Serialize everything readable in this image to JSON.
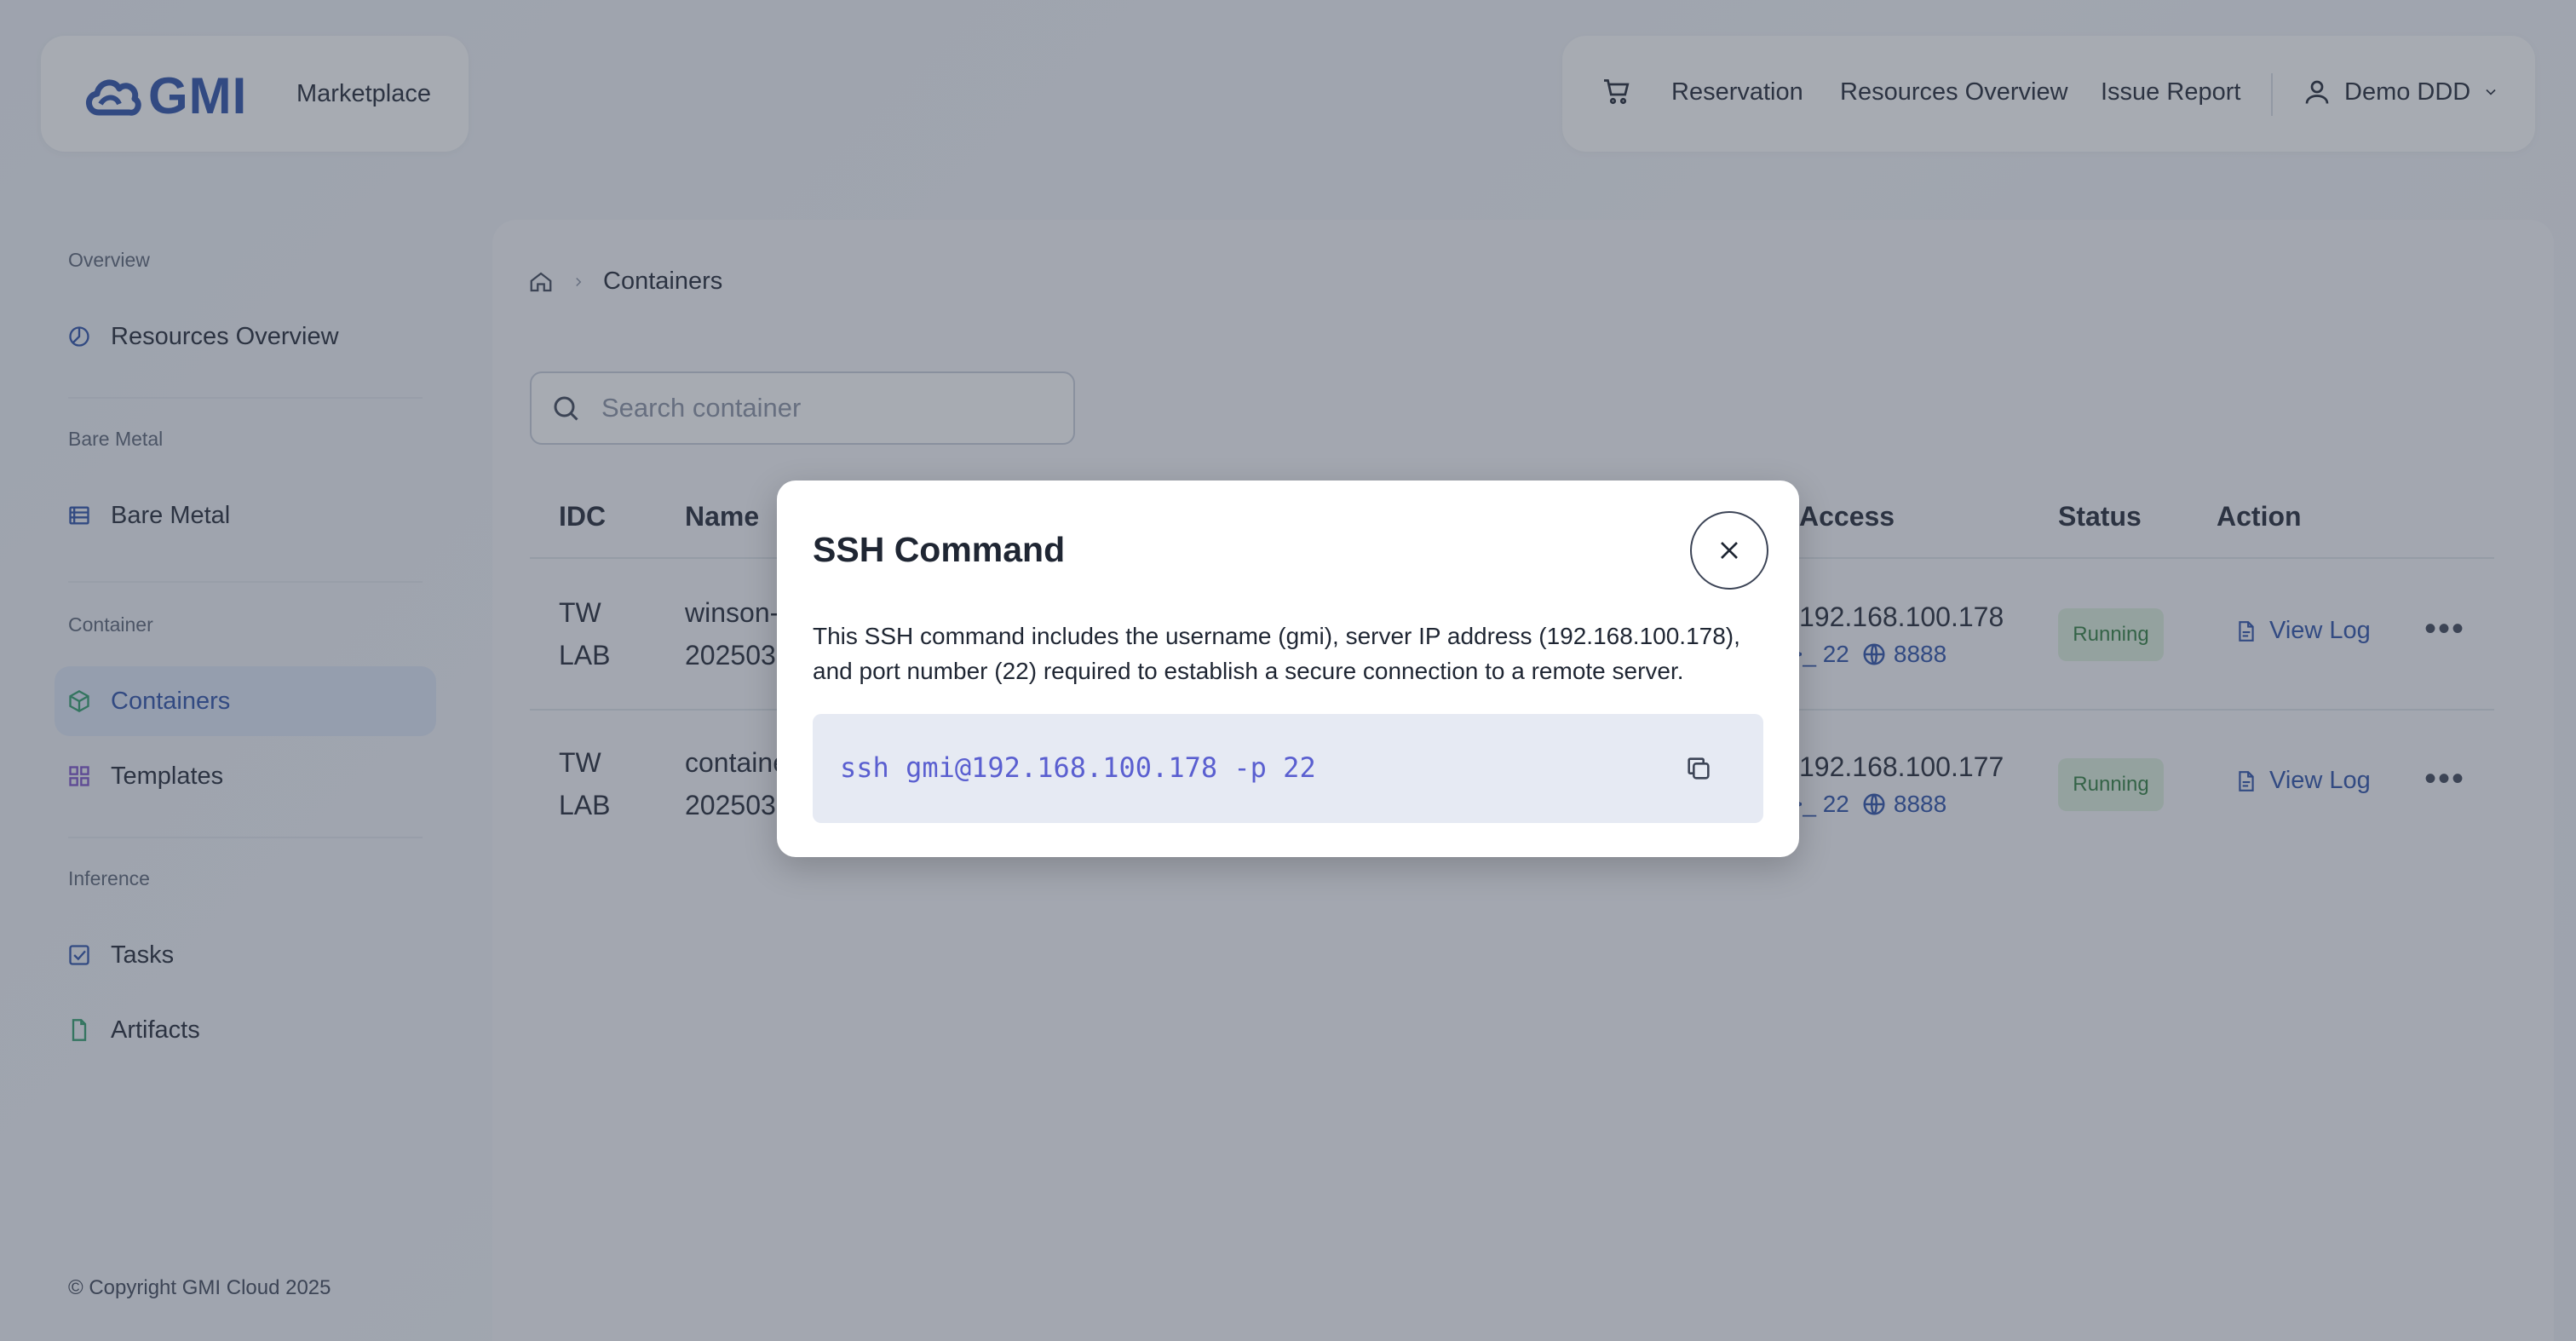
{
  "header": {
    "logo_text": "GMI",
    "marketplace_label": "Marketplace",
    "nav": {
      "cart_icon": "cart-icon",
      "reservation": "Reservation",
      "resources_overview": "Resources Overview",
      "issue_report": "Issue Report",
      "user_name": "Demo DDD"
    }
  },
  "sidebar": {
    "sections": {
      "overview": "Overview",
      "bare_metal": "Bare Metal",
      "container": "Container",
      "inference": "Inference"
    },
    "items": {
      "resources_overview": "Resources Overview",
      "bare_metal": "Bare Metal",
      "containers": "Containers",
      "templates": "Templates",
      "tasks": "Tasks",
      "artifacts": "Artifacts"
    },
    "copyright": "© Copyright GMI Cloud 2025"
  },
  "main": {
    "breadcrumb": {
      "current": "Containers"
    },
    "search": {
      "placeholder": "Search container"
    },
    "table": {
      "headers": {
        "idc": "IDC",
        "name": "Name",
        "access": "Access",
        "status": "Status",
        "action": "Action"
      },
      "rows": [
        {
          "idc_line1": "TW",
          "idc_line2": "LAB",
          "name_line1": "winson-",
          "name_line2": "202503",
          "ip": "192.168.100.178",
          "ssh_port": "22",
          "web_port": "8888",
          "status": "Running",
          "action": "View Log"
        },
        {
          "idc_line1": "TW",
          "idc_line2": "LAB",
          "name_line1": "containe",
          "name_line2": "202503",
          "ip": "192.168.100.177",
          "ssh_port": "22",
          "web_port": "8888",
          "status": "Running",
          "action": "View Log"
        }
      ]
    }
  },
  "modal": {
    "title": "SSH Command",
    "description": "This SSH command includes the username (gmi), server IP address (192.168.100.178), and port number (22) required to establish a secure connection to a remote server.",
    "command": "ssh gmi@192.168.100.178 -p 22"
  },
  "colors": {
    "accent": "#2a4fa8",
    "command_text": "#5a5fd0",
    "status_bg": "#dcefdc",
    "status_text": "#2e7d3d"
  }
}
